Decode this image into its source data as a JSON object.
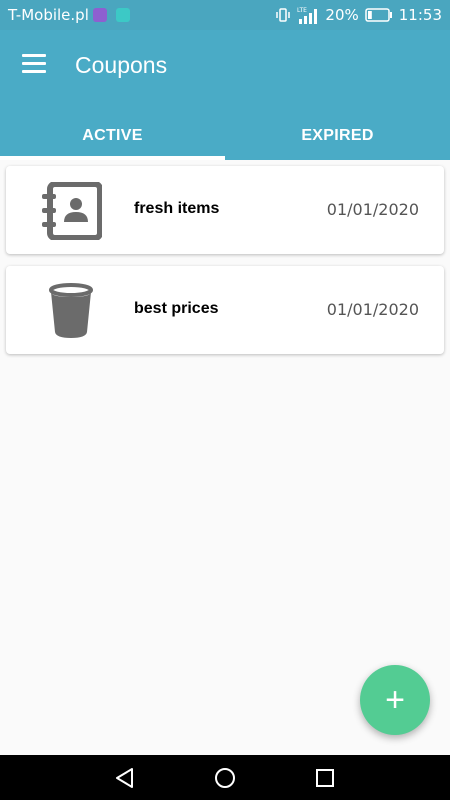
{
  "status_bar": {
    "carrier": "T-Mobile.pl",
    "network": "LTE",
    "battery": "20%",
    "battery_level": 0.2,
    "time": "11:53"
  },
  "app_bar": {
    "title": "Coupons",
    "tabs": [
      {
        "label": "ACTIVE",
        "selected": true
      },
      {
        "label": "EXPIRED",
        "selected": false
      }
    ]
  },
  "coupons": [
    {
      "icon": "contact-book-icon",
      "label": "fresh items",
      "date": "01/01/2020"
    },
    {
      "icon": "trash-bin-icon",
      "label": "best prices",
      "date": "01/01/2020"
    }
  ],
  "fab": {
    "icon": "plus-icon",
    "symbol": "+"
  },
  "colors": {
    "primary": "#4aabc6",
    "status_bar": "#4aa6bf",
    "fab": "#53cc93",
    "icon_gray": "#6b6b6b"
  }
}
